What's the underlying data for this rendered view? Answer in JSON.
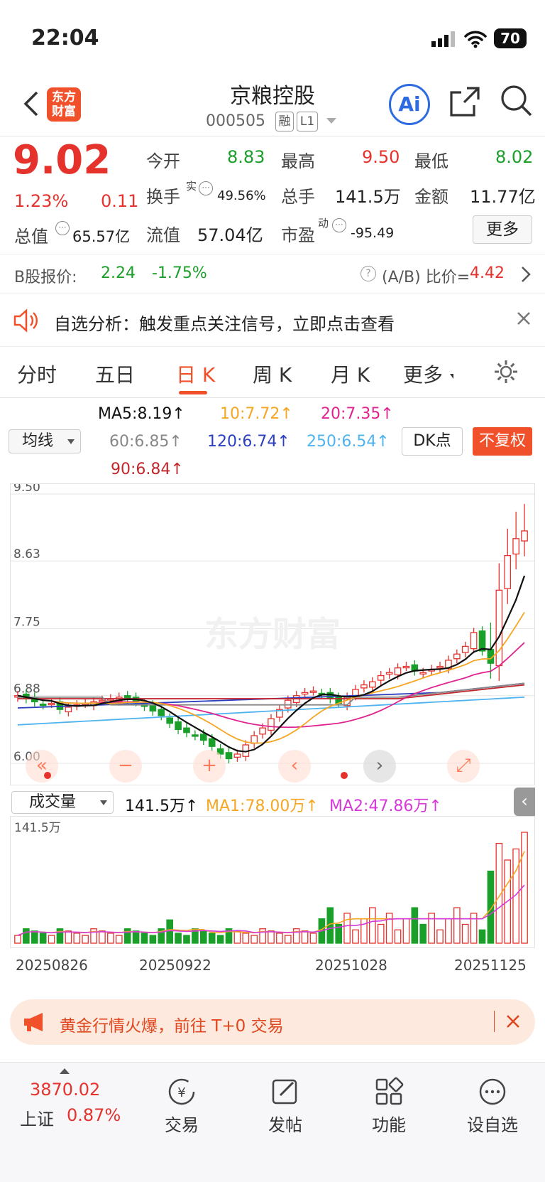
{
  "status": {
    "time": "22:04",
    "battery": "70"
  },
  "header": {
    "title": "京粮控股",
    "code": "000505",
    "tag1": "融",
    "tag2": "L1",
    "logo": "东方\n财富",
    "ai": "Ai"
  },
  "quote": {
    "price": "9.02",
    "pct": "1.23%",
    "chg": "0.11",
    "open_label": "今开",
    "open": "8.83",
    "high_label": "最高",
    "high": "9.50",
    "low_label": "最低",
    "low": "8.02",
    "turnover_label": "换手",
    "turnover_sup": "实",
    "turnover": "49.56%",
    "vol_label": "总手",
    "vol": "141.5万",
    "amt_label": "金额",
    "amt": "11.77亿",
    "mcap_label": "总值",
    "mcap": "65.57亿",
    "float_label": "流值",
    "float": "57.04亿",
    "pe_label": "市盈",
    "pe_sup": "动",
    "pe": "-95.49",
    "more": "更多"
  },
  "bshare": {
    "label": "B股报价:",
    "price": "2.24",
    "pct": "-1.75%",
    "ratio_label": "(A/B) 比价=",
    "ratio": "4.42"
  },
  "notice": {
    "text": "自选分析：触发重点关注信号，立即点击查看"
  },
  "tabs": [
    "分时",
    "五日",
    "日 K",
    "周 K",
    "月 K",
    "更多"
  ],
  "active_tab": 2,
  "ma": {
    "selector": "均线",
    "ma5": "MA5:8.19↑",
    "ma10": "10:7.72↑",
    "ma20": "20:7.35↑",
    "ma60": "60:6.85↑",
    "ma120": "120:6.74↑",
    "ma250": "250:6.54↑",
    "ma90": "90:6.84↑",
    "dk": "DK点",
    "adj": "不复权"
  },
  "chart_data": {
    "type": "candlestick",
    "y_ticks": [
      "9.50",
      "8.63",
      "7.75",
      "6.88",
      "6.00"
    ],
    "ylim": [
      6.0,
      9.5
    ],
    "x_ticks": [
      "20250826",
      "20250922",
      "20251028",
      "20251125"
    ],
    "close": [
      6.88,
      6.84,
      6.8,
      6.76,
      6.78,
      6.7,
      6.73,
      6.76,
      6.78,
      6.8,
      6.82,
      6.84,
      6.86,
      6.84,
      6.8,
      6.74,
      6.68,
      6.62,
      6.52,
      6.44,
      6.4,
      6.36,
      6.3,
      6.22,
      6.12,
      6.06,
      6.12,
      6.24,
      6.36,
      6.46,
      6.58,
      6.7,
      6.82,
      6.88,
      6.92,
      6.94,
      6.9,
      6.84,
      6.78,
      6.86,
      6.96,
      7.02,
      7.06,
      7.14,
      7.18,
      7.24,
      7.26,
      7.2,
      7.18,
      7.22,
      7.26,
      7.34,
      7.42,
      7.52,
      7.7,
      7.46,
      7.3,
      8.25,
      8.7,
      8.92,
      9.02
    ],
    "colors": {
      "ma5": "#111111",
      "ma10": "#f5a623",
      "ma20": "#e0248f",
      "ma60": "#888888",
      "ma90": "#c0282d",
      "ma120": "#2b3fc0",
      "ma250": "#4fb3f0",
      "up": "#e5322d",
      "down": "#1aa02a"
    }
  },
  "volume": {
    "selector": "成交量",
    "value": "141.5万↑",
    "ma1": "MA1:78.00万↑",
    "ma2": "MA2:47.86万↑",
    "top": "141.5万"
  },
  "banner": {
    "text": "黄金行情火爆，前往 T+0 交易"
  },
  "bottom": {
    "index_val": "3870.02",
    "index_name": "上证",
    "index_pct": "0.87%",
    "items": [
      "交易",
      "发帖",
      "功能",
      "设自选"
    ]
  }
}
